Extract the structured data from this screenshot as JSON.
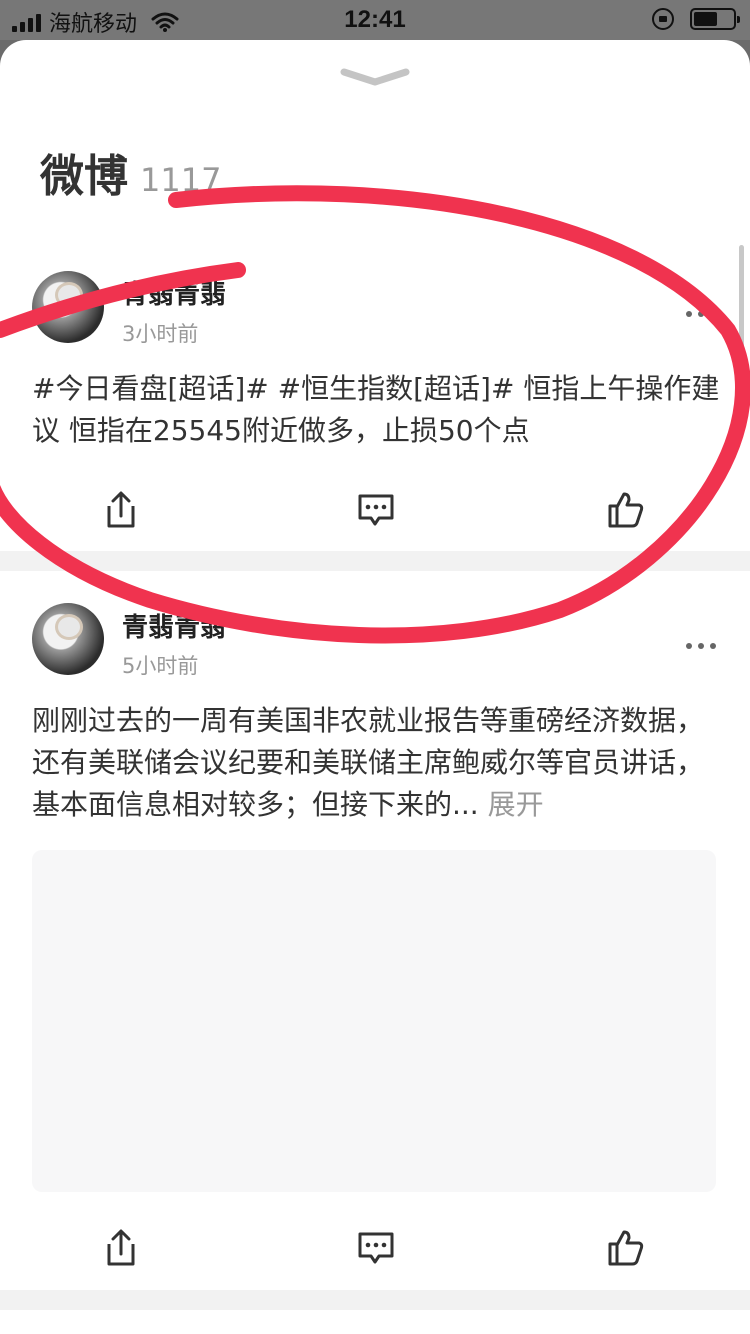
{
  "status_bar": {
    "carrier": "海航移动",
    "time": "12:41"
  },
  "sheet": {
    "title": "微博",
    "count": "1117"
  },
  "posts": [
    {
      "author": "青翡青翡",
      "time": "3小时前",
      "content": "#今日看盘[超话]# #恒生指数[超话]# 恒指上午操作建议 恒指在25545附近做多，止损50个点"
    },
    {
      "author": "青翡青翡",
      "time": "5小时前",
      "content": "刚刚过去的一周有美国非农就业报告等重磅经济数据，还有美联储会议纪要和美联储主席鲍威尔等官员讲话，基本面信息相对较多；但接下来的...",
      "expand_label": "展开"
    }
  ],
  "icons": {
    "share": "share-icon",
    "comment": "comment-icon",
    "like": "like-icon",
    "more": "more-icon"
  },
  "colors": {
    "annotation_stroke": "#f0334f"
  }
}
